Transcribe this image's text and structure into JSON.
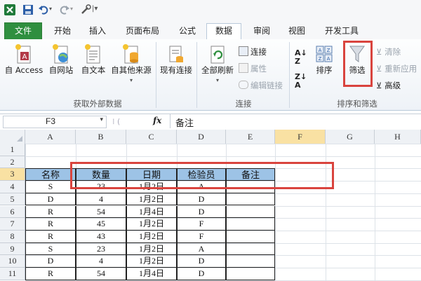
{
  "ribbon_tabs": [
    "文件",
    "开始",
    "插入",
    "页面布局",
    "公式",
    "数据",
    "审阅",
    "视图",
    "开发工具"
  ],
  "active_tab": "数据",
  "external_data": {
    "buttons": [
      "自 Access",
      "自网站",
      "自文本",
      "自其他来源",
      "现有连接"
    ],
    "group_label": "获取外部数据"
  },
  "connections": {
    "refresh_all": "全部刷新",
    "connections_btn": "连接",
    "properties_btn": "属性",
    "edit_links_btn": "编辑链接",
    "group_label": "连接"
  },
  "sort_filter": {
    "sort_btn": "排序",
    "filter_btn": "筛选",
    "clear_btn": "清除",
    "reapply_btn": "重新应用",
    "advanced_btn": "高级",
    "group_label": "排序和筛选"
  },
  "formula_bar": {
    "name_box": "F3",
    "fx": "fx",
    "content": "备注"
  },
  "columns": [
    "A",
    "B",
    "C",
    "D",
    "E",
    "F",
    "G",
    "H"
  ],
  "rows": [
    "1",
    "2",
    "3",
    "4",
    "5",
    "6",
    "7",
    "8",
    "9",
    "10",
    "11"
  ],
  "table": {
    "headers": [
      "名称",
      "数量",
      "日期",
      "检验员",
      "备注"
    ],
    "rows": [
      [
        "S",
        "23",
        "1月2日",
        "A",
        ""
      ],
      [
        "D",
        "4",
        "1月2日",
        "D",
        ""
      ],
      [
        "R",
        "54",
        "1月4日",
        "D",
        ""
      ],
      [
        "R",
        "45",
        "1月2日",
        "F",
        ""
      ],
      [
        "R",
        "43",
        "1月2日",
        "F",
        ""
      ],
      [
        "S",
        "23",
        "1月2日",
        "A",
        ""
      ],
      [
        "D",
        "4",
        "1月2日",
        "D",
        ""
      ],
      [
        "R",
        "54",
        "1月4日",
        "D",
        ""
      ]
    ]
  },
  "colors": {
    "file_tab": "#2f8f3f",
    "highlight": "#d9443e",
    "header_fill": "#9dc3e6"
  }
}
